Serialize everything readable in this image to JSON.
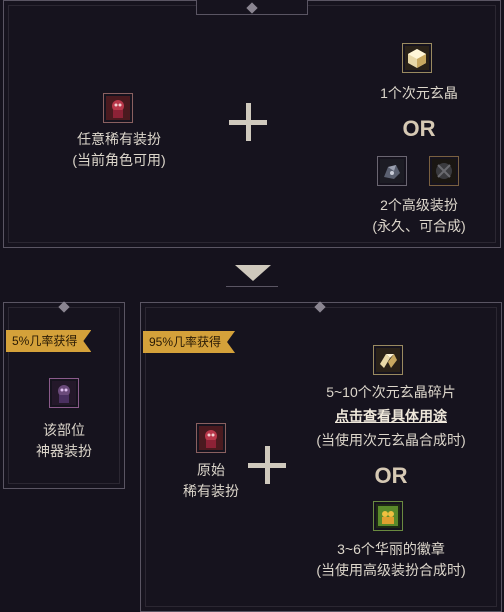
{
  "top_recipe": {
    "input_label_line1": "任意稀有装扮",
    "input_label_line2": "(当前角色可用)",
    "option1_label": "1个次元玄晶",
    "or_label": "OR",
    "option2_label_line1": "2个高级装扮",
    "option2_label_line2": "(永久、可合成)"
  },
  "left_result": {
    "badge": "5%几率获得",
    "label_line1": "该部位",
    "label_line2": "神器装扮"
  },
  "right_result": {
    "badge": "95%几率获得",
    "input_label_line1": "原始",
    "input_label_line2": "稀有装扮",
    "option1_label": "5~10个次元玄晶碎片",
    "option1_link": "点击查看具体用途",
    "option1_note": "(当使用次元玄晶合成时)",
    "or_label": "OR",
    "option2_label": "3~6个华丽的徽章",
    "option2_note": "(当使用高级装扮合成时)"
  },
  "colors": {
    "background": "#15121d",
    "border": "#5a5563",
    "badge": "#d4a13a",
    "text": "#dcd6cb"
  },
  "icons": {
    "rare_costume": "rare-costume-icon",
    "dimension_crystal": "dimension-crystal-icon",
    "advanced_costume_a": "advanced-costume-icon",
    "advanced_costume_b": "advanced-costume-icon",
    "artifact_costume": "artifact-costume-icon",
    "crystal_fragment": "crystal-fragment-icon",
    "badge": "gorgeous-badge-icon"
  }
}
